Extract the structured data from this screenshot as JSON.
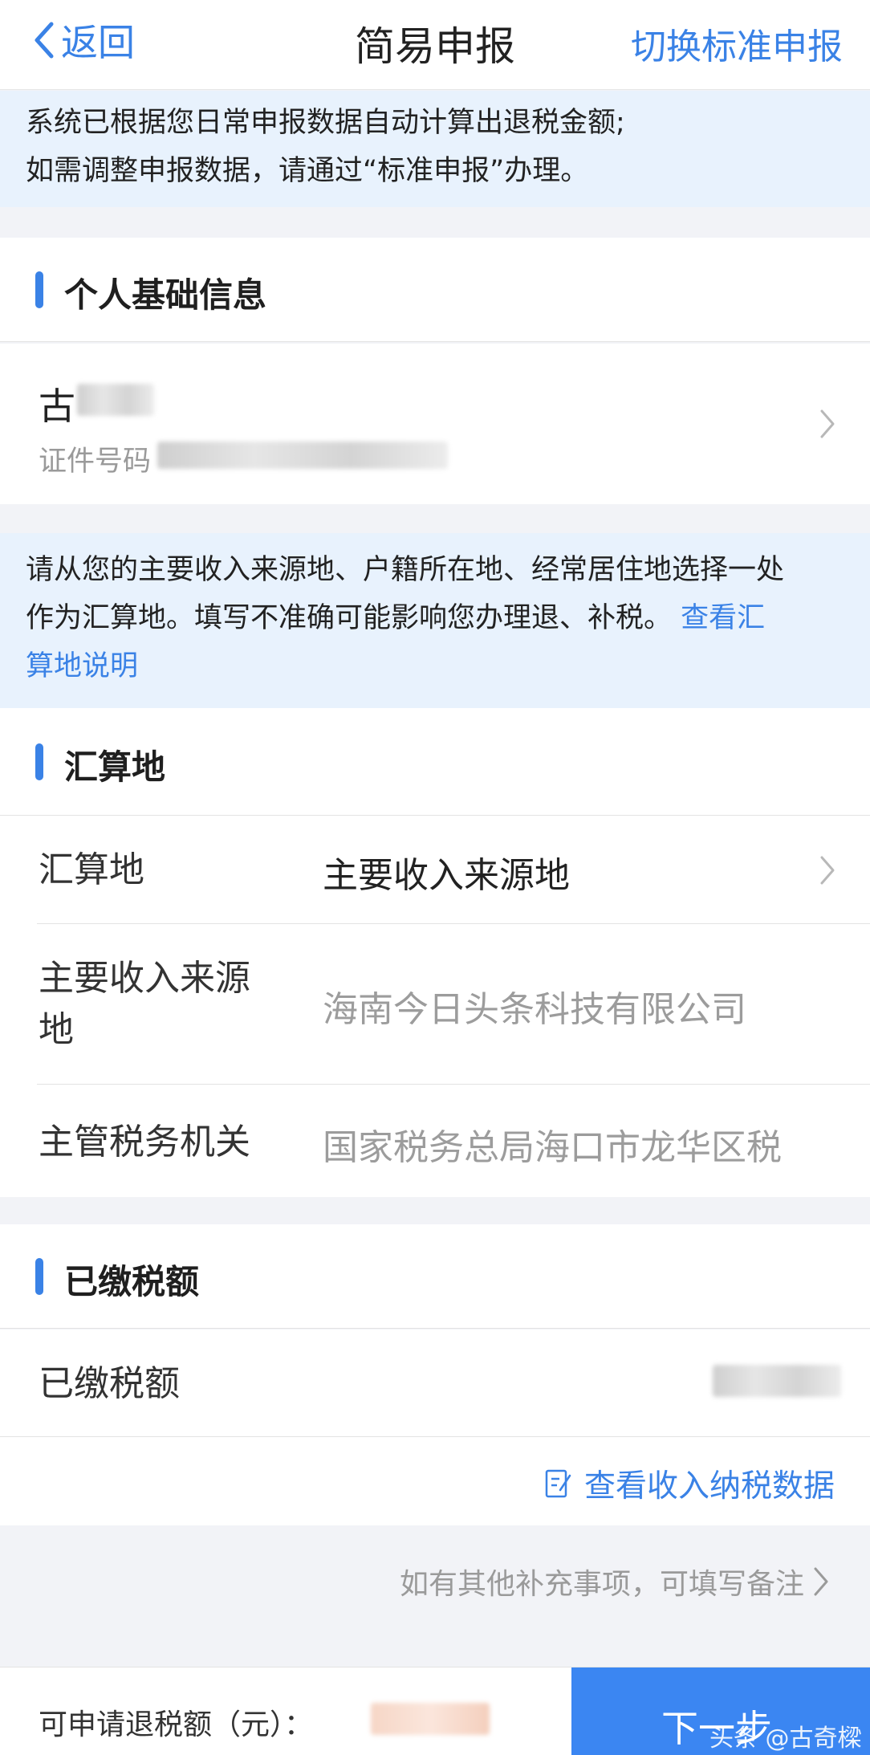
{
  "nav": {
    "back_label": "返回",
    "title": "简易申报",
    "switch_label": "切换标准申报"
  },
  "notice_top": {
    "line1": "系统已根据您日常申报数据自动计算出退税金额;",
    "line2": "如需调整申报数据，请通过“标准申报”办理。"
  },
  "personal": {
    "section_title": "个人基础信息",
    "name_visible": "古",
    "id_label": "证件号码"
  },
  "notice_middle": {
    "line1": "请从您的主要收入来源地、户籍所在地、经常居住地选择一处",
    "line2_prefix": "作为汇算地。填写不准确可能影响您办理退、补税。",
    "link_part1": "查看汇",
    "link_part2": "算地说明"
  },
  "settlement": {
    "section_title": "汇算地",
    "rows": [
      {
        "label": "汇算地",
        "value": "主要收入来源地"
      },
      {
        "label_line1": "主要收入来源",
        "label_line2": "地",
        "value": "海南今日头条科技有限公司"
      },
      {
        "label": "主管税务机关",
        "value": "国家税务总局海口市龙华区税"
      }
    ]
  },
  "paid_tax": {
    "section_title": "已缴税额",
    "row_label": "已缴税额"
  },
  "links": {
    "view_income_tax_data": "查看收入纳税数据",
    "remark_hint": "如有其他补充事项，可填写备注"
  },
  "bottom": {
    "refund_label": "可申请退税额（元）：",
    "next_button": "下一步"
  },
  "watermark": "头条 @古奇樑",
  "colors": {
    "accent": "#3a82e6",
    "notice_bg": "#e8f2fd",
    "page_bg": "#f2f3f7",
    "button_bg": "#3b86f2",
    "muted_text": "#9c9c9c"
  },
  "icons": {
    "back": "chevron-left-icon",
    "row_arrow": "chevron-right-icon",
    "edit": "edit-document-icon"
  }
}
